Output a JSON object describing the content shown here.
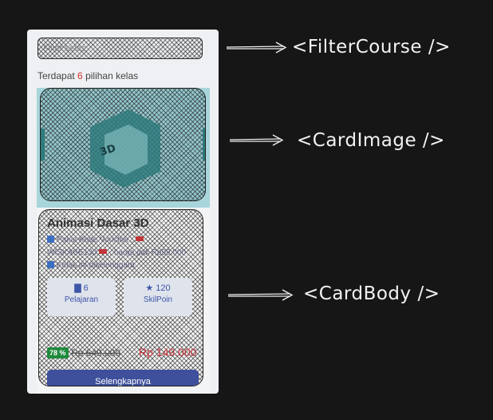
{
  "filter": {
    "placeholder": "Filter kelas"
  },
  "result": {
    "prefix": "Terdapat",
    "count": "6",
    "suffix": "pilihan kelas"
  },
  "course": {
    "title": "Animasi Dasar 3D",
    "promo": {
      "line1": "Pakai Kode Voucher :",
      "line2": "WISKASE130",
      "line3": ", harga jadi",
      "line4": "Rp99.000",
      "line5": "Kelas ini diselenggara"
    },
    "stats": [
      {
        "icon": "book-icon",
        "value": "6",
        "label": "Pelajaran"
      },
      {
        "icon": "star-icon",
        "value": "120",
        "label": "SkilPoin"
      }
    ],
    "discount": "78 %",
    "old_price": "Rp 649.000",
    "price": "Rp 149.000",
    "button": "Selengkapnya"
  },
  "annotations": {
    "filter": "<FilterCourse />",
    "image": "<CardImage />",
    "body": "<CardBody />"
  },
  "colors": {
    "background": "#161616",
    "image_bg": "#a7d5db",
    "accent_red": "#d9322b",
    "button_blue": "#3e4f9c",
    "badge_green": "#1f8a3c"
  }
}
